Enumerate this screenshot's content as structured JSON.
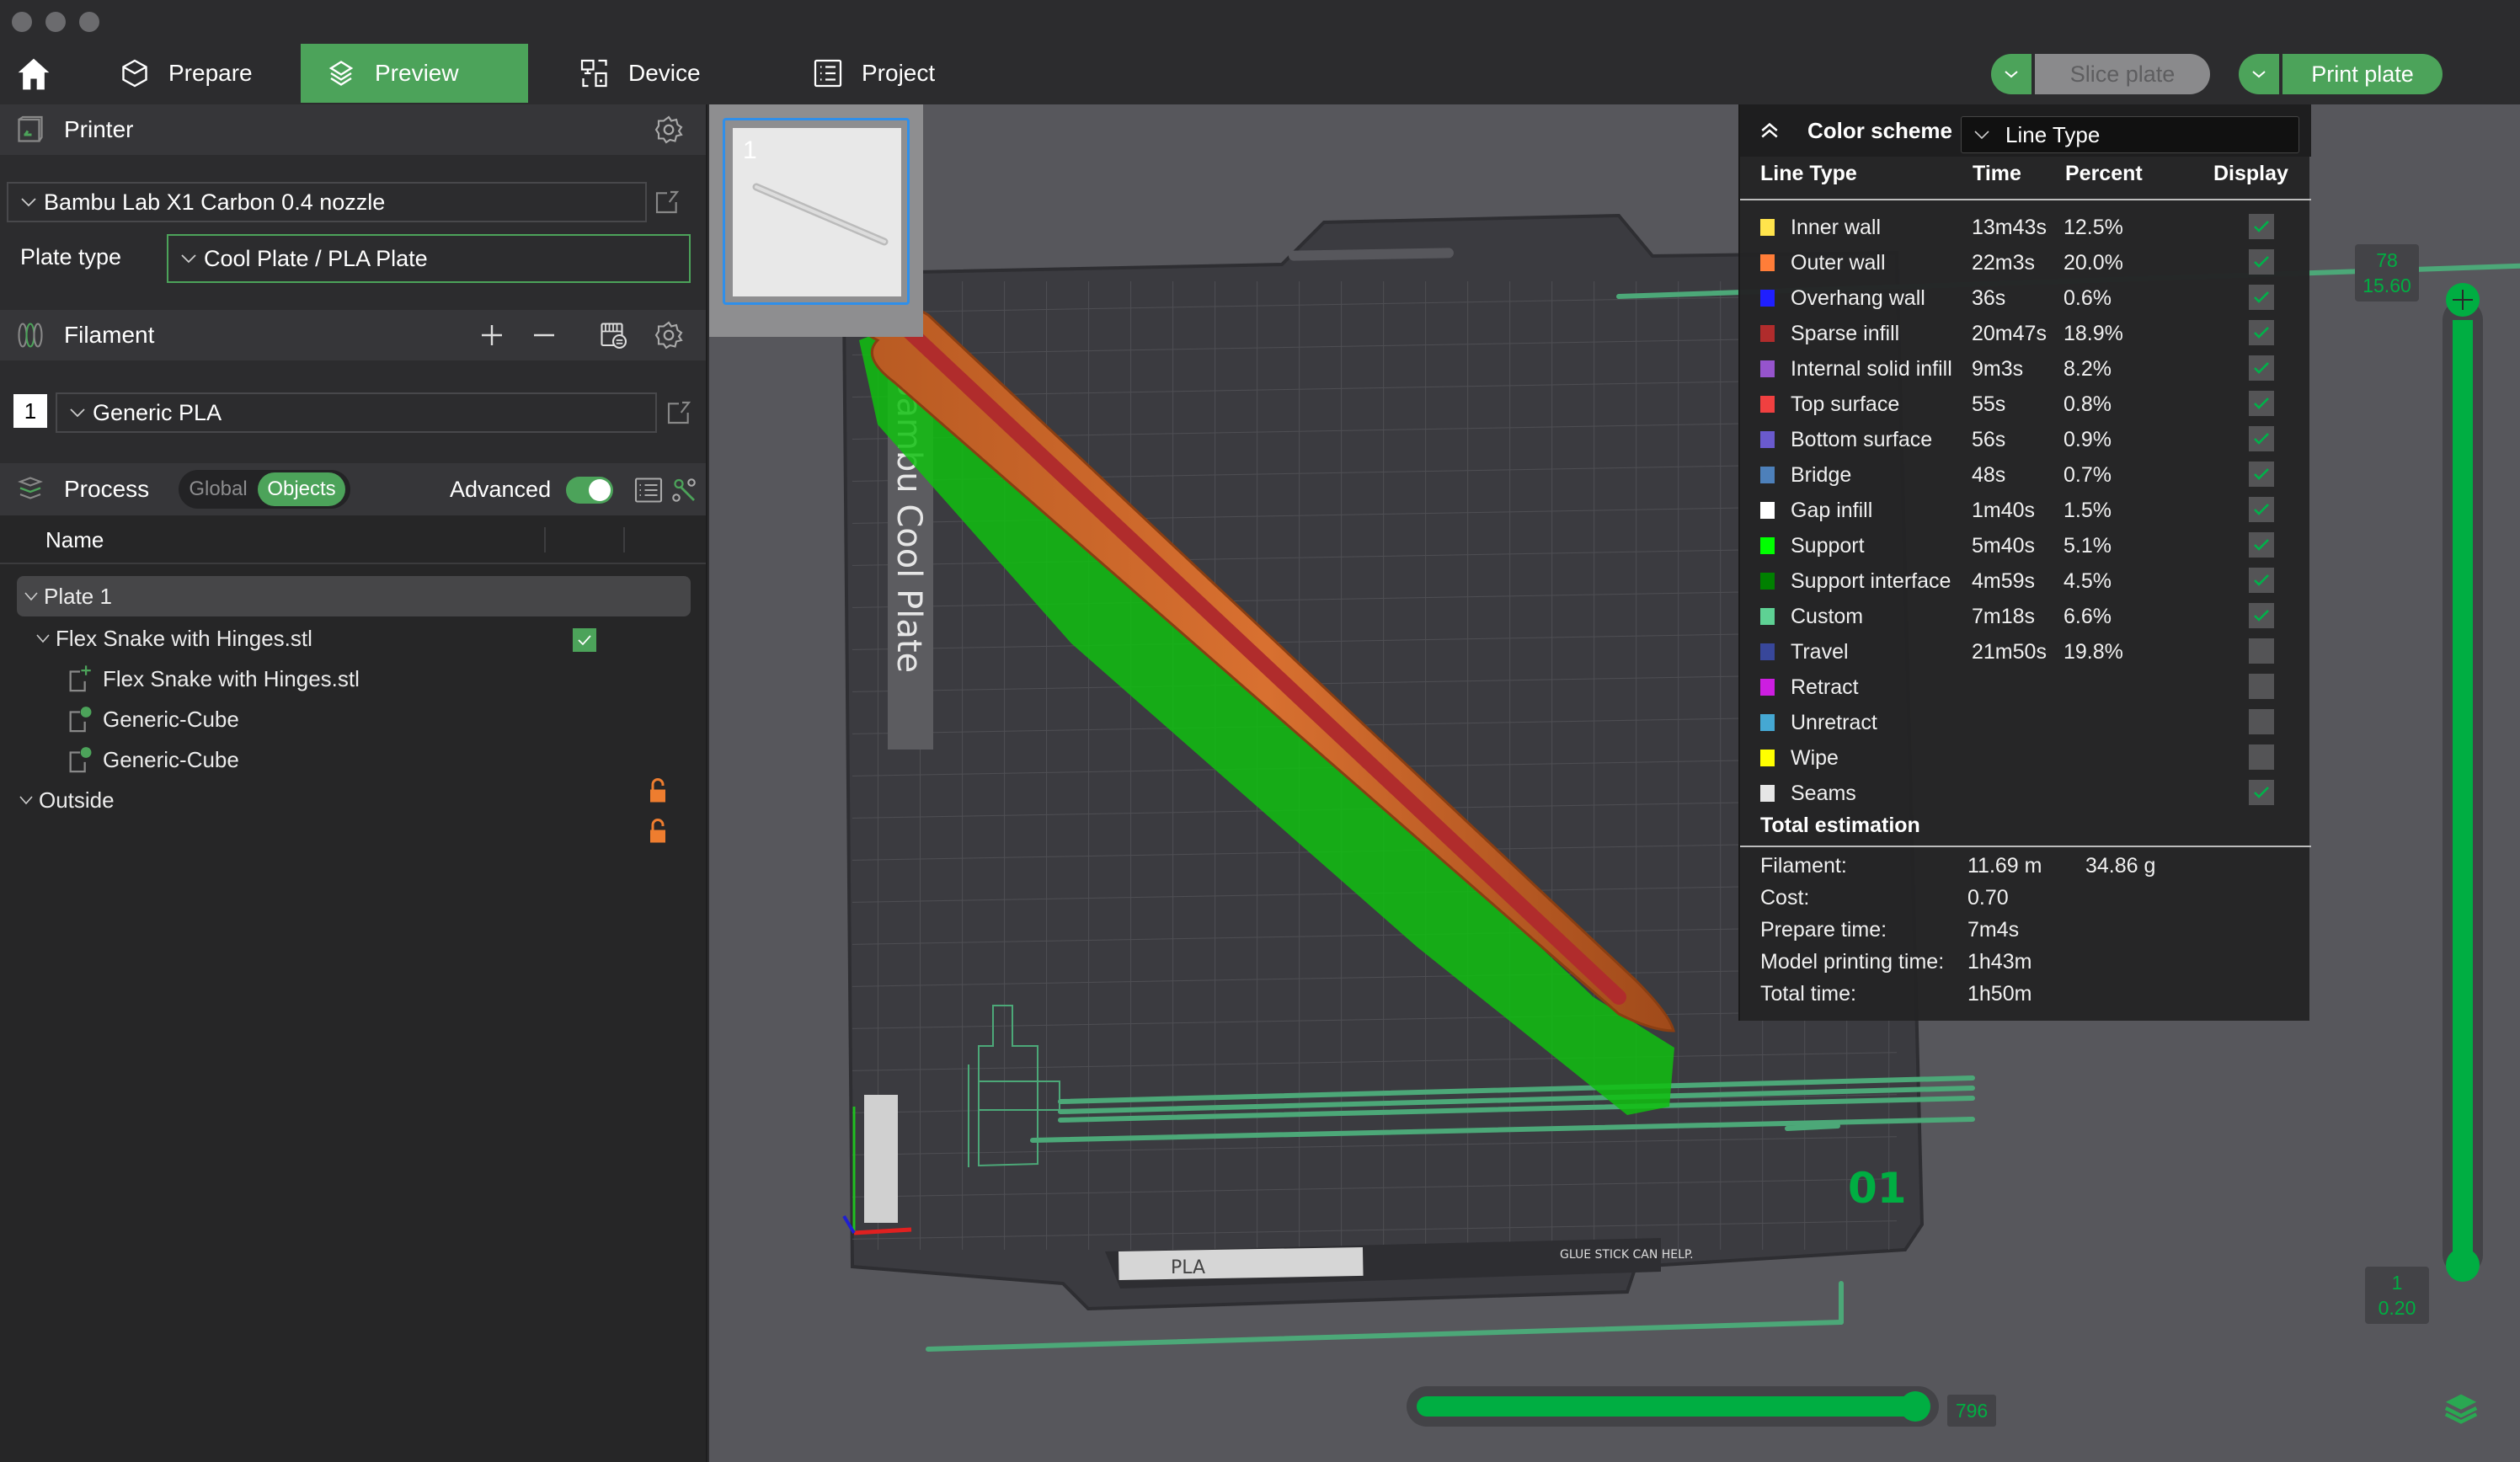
{
  "nav": {
    "home_icon": "home-icon",
    "tabs": [
      {
        "label": "Prepare",
        "icon": "cube-icon",
        "active": false
      },
      {
        "label": "Preview",
        "icon": "layers-icon",
        "active": true
      },
      {
        "label": "Device",
        "icon": "device-icon",
        "active": false
      },
      {
        "label": "Project",
        "icon": "list-icon",
        "active": false
      }
    ],
    "slice_label": "Slice plate",
    "print_label": "Print plate",
    "accent": "#4ca35a"
  },
  "printer": {
    "title": "Printer",
    "selected": "Bambu Lab X1 Carbon 0.4 nozzle",
    "plate_type_label": "Plate type",
    "plate_type": "Cool Plate / PLA Plate"
  },
  "filament": {
    "title": "Filament",
    "items": [
      {
        "index": "1",
        "name": "Generic PLA"
      }
    ]
  },
  "process": {
    "title": "Process",
    "seg_global": "Global",
    "seg_objects": "Objects",
    "seg_selected": "Objects",
    "advanced_label": "Advanced",
    "advanced_on": true
  },
  "object_tree": {
    "col_name": "Name",
    "plate": "Plate 1",
    "object": "Flex Snake with Hinges.stl",
    "object_checked": true,
    "parts": [
      {
        "name": "Flex Snake with Hinges.stl",
        "locked": null
      },
      {
        "name": "Generic-Cube",
        "locked": false
      },
      {
        "name": "Generic-Cube",
        "locked": false
      }
    ],
    "outside": "Outside"
  },
  "viewport": {
    "plate_thumb_number": "1",
    "bed_label": "Bambu Cool Plate",
    "bed_plate_number": "01",
    "bed_sticker_material": "PLA",
    "bed_sticker_note": "GLUE STICK CAN HELP."
  },
  "legend": {
    "title": "Color scheme",
    "scheme": "Line Type",
    "headers": {
      "type": "Line Type",
      "time": "Time",
      "percent": "Percent",
      "display": "Display"
    },
    "rows": [
      {
        "name": "Inner wall",
        "color": "#ffe44c",
        "time": "13m43s",
        "percent": "12.5%",
        "display": true
      },
      {
        "name": "Outer wall",
        "color": "#ff7d38",
        "time": "22m3s",
        "percent": "20.0%",
        "display": true
      },
      {
        "name": "Overhang wall",
        "color": "#1f1fff",
        "time": "36s",
        "percent": "0.6%",
        "display": true
      },
      {
        "name": "Sparse infill",
        "color": "#b02c2c",
        "time": "20m47s",
        "percent": "18.9%",
        "display": true
      },
      {
        "name": "Internal solid infill",
        "color": "#9654cc",
        "time": "9m3s",
        "percent": "8.2%",
        "display": true
      },
      {
        "name": "Top surface",
        "color": "#f04040",
        "time": "55s",
        "percent": "0.8%",
        "display": true
      },
      {
        "name": "Bottom surface",
        "color": "#6a5acd",
        "time": "56s",
        "percent": "0.9%",
        "display": true
      },
      {
        "name": "Bridge",
        "color": "#4d80ba",
        "time": "48s",
        "percent": "0.7%",
        "display": true
      },
      {
        "name": "Gap infill",
        "color": "#ffffff",
        "time": "1m40s",
        "percent": "1.5%",
        "display": true
      },
      {
        "name": "Support",
        "color": "#00ff00",
        "time": "5m40s",
        "percent": "5.1%",
        "display": true
      },
      {
        "name": "Support interface",
        "color": "#008000",
        "time": "4m59s",
        "percent": "4.5%",
        "display": true
      },
      {
        "name": "Custom",
        "color": "#5ed194",
        "time": "7m18s",
        "percent": "6.6%",
        "display": true
      },
      {
        "name": "Travel",
        "color": "#38479a",
        "time": "21m50s",
        "percent": "19.8%",
        "display": false
      },
      {
        "name": "Retract",
        "color": "#cd1ee1",
        "time": "",
        "percent": "",
        "display": false
      },
      {
        "name": "Unretract",
        "color": "#45a8d3",
        "time": "",
        "percent": "",
        "display": false
      },
      {
        "name": "Wipe",
        "color": "#ffff00",
        "time": "",
        "percent": "",
        "display": false
      },
      {
        "name": "Seams",
        "color": "#e6e6e6",
        "time": "",
        "percent": "",
        "display": true
      }
    ],
    "estimation": {
      "title": "Total estimation",
      "filament_label": "Filament:",
      "filament_length": "11.69 m",
      "filament_weight": "34.86 g",
      "cost_label": "Cost:",
      "cost": "0.70",
      "prepare_label": "Prepare time:",
      "prepare": "7m4s",
      "model_label": "Model printing time:",
      "model": "1h43m",
      "total_label": "Total time:",
      "total": "1h50m"
    }
  },
  "layer_slider": {
    "top_layer": "78",
    "top_height": "15.60",
    "bottom_layer": "1",
    "bottom_height": "0.20",
    "color": "#00ae42"
  },
  "move_slider": {
    "value": "796",
    "fraction": 1.0
  }
}
